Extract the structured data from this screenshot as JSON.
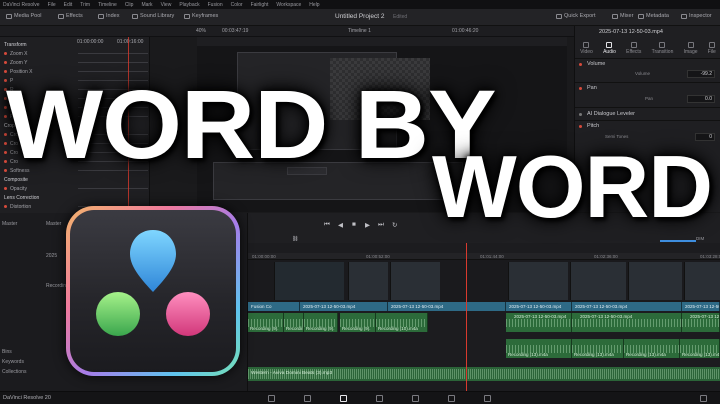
{
  "menu": [
    "DaVinci Resolve",
    "File",
    "Edit",
    "Trim",
    "Timeline",
    "Clip",
    "Mark",
    "View",
    "Playback",
    "Fusion",
    "Color",
    "Fairlight",
    "Workspace",
    "Help"
  ],
  "toolbar": {
    "media_pool": "Media Pool",
    "effects": "Effects",
    "index": "Index",
    "sound_library": "Sound Library",
    "keyframes": "Keyframes",
    "project_title": "Untitled Project 2",
    "project_status": "Edited",
    "quick_export": "Quick Export",
    "mixer": "Mixer",
    "metadata": "Metadata",
    "inspector": "Inspector"
  },
  "viewer": {
    "zoom": "40%",
    "source_timecode": "00:03:47:19",
    "timeline_name": "Timeline 1",
    "record_timecode": "01:00:46:20",
    "ruler_marks": [
      "01:00:00:00",
      "01:00:16:00"
    ]
  },
  "left_inspector": {
    "rows": [
      {
        "label": "Transform",
        "type": "section"
      },
      {
        "label": "Zoom X",
        "type": "param"
      },
      {
        "label": "Zoom Y",
        "type": "param"
      },
      {
        "label": "Position X",
        "type": "param"
      },
      {
        "label": "P",
        "type": "param"
      },
      {
        "label": "R",
        "type": "param"
      },
      {
        "label": "An",
        "type": "param"
      },
      {
        "label": "A",
        "type": "param"
      },
      {
        "label": "Fli",
        "type": "param"
      },
      {
        "label": "Crop",
        "type": "section"
      },
      {
        "label": "Cro",
        "type": "param"
      },
      {
        "label": "Cro",
        "type": "param"
      },
      {
        "label": "Cro",
        "type": "param"
      },
      {
        "label": "Cro",
        "type": "param"
      },
      {
        "label": "Softness",
        "type": "param"
      },
      {
        "label": "Composite",
        "type": "section"
      },
      {
        "label": "Opacity",
        "type": "param"
      },
      {
        "label": "Lens Correction",
        "type": "section"
      },
      {
        "label": "Distortion",
        "type": "param"
      }
    ]
  },
  "inspector": {
    "clip_name": "2025-07-13 12-50-03.mp4",
    "tabs": [
      "Video",
      "Audio",
      "Effects",
      "Transition",
      "Image",
      "File"
    ],
    "active_tab": "Audio",
    "volume_section": "Volume",
    "volume_label": "Volume",
    "volume_value": "-99.2",
    "pan_section": "Pan",
    "pan_label": "Pan",
    "pan_value": "0.0",
    "ai_dialogue": "AI Dialogue Leveler",
    "pitch_section": "Pitch",
    "semitones_label": "Semi Tones",
    "semitones_value": "0"
  },
  "pool": {
    "master_label": "Master",
    "master_label_2": "Master",
    "bins_label": "Bins",
    "keywords_label": "Keywords",
    "collections_label": "Collections",
    "item_a": "2025",
    "item_b": "Recordin"
  },
  "timeline": {
    "ruler": [
      "01:00:00:00",
      "01:00:52:00",
      "01:01:44:00",
      "01:02:36:00",
      "01:03:28:00"
    ],
    "video_clips": [
      "Fusion Co",
      "2025-07-13 12-50-03.mp4",
      "2025-07-13 12-50-03.mp4",
      "2025-07-13 12-50-03.mp4",
      "2025-07-13 12-50-03.mp4",
      "2025-07-13 12-50-03.mp4"
    ],
    "audio_upper": [
      "Recording (9).",
      "Recording (9).",
      "Recording (9).",
      "Recording (9).",
      "Recording (10).m4a"
    ],
    "audio_upper_right_header": [
      "2025-07-13 12-50-03.mp4",
      "2025-07-13 12-50-03.mp4",
      "2025-07-13 12-50-03.mp4"
    ],
    "audio_lower": [
      "Recording (13).m4a",
      "Recording (13).m4a",
      "Recording (13).m4a",
      "Recording (13).m4a"
    ],
    "music_track": "Western - Aviva Domini Beats (3).mp3",
    "master_volume": "DIM"
  },
  "headline": {
    "line1": "WORD BY",
    "line2": "WORD"
  },
  "footer": {
    "version": "DaVinci Resolve 20"
  },
  "colors": {
    "video_clip": "#2e6a86",
    "audio_clip": "#2c6b3a",
    "playhead": "#d83a2e",
    "logo_blue": "#4fb8f0",
    "logo_green": "#79d36c",
    "logo_pink": "#ec6aa0"
  },
  "icons": [
    "media-pool-icon",
    "effects-icon",
    "index-icon",
    "sound-library-icon",
    "keyframes-icon",
    "quick-export-icon",
    "mixer-icon",
    "metadata-icon",
    "inspector-icon",
    "play-icon",
    "stop-icon",
    "davinci-resolve-logo"
  ]
}
